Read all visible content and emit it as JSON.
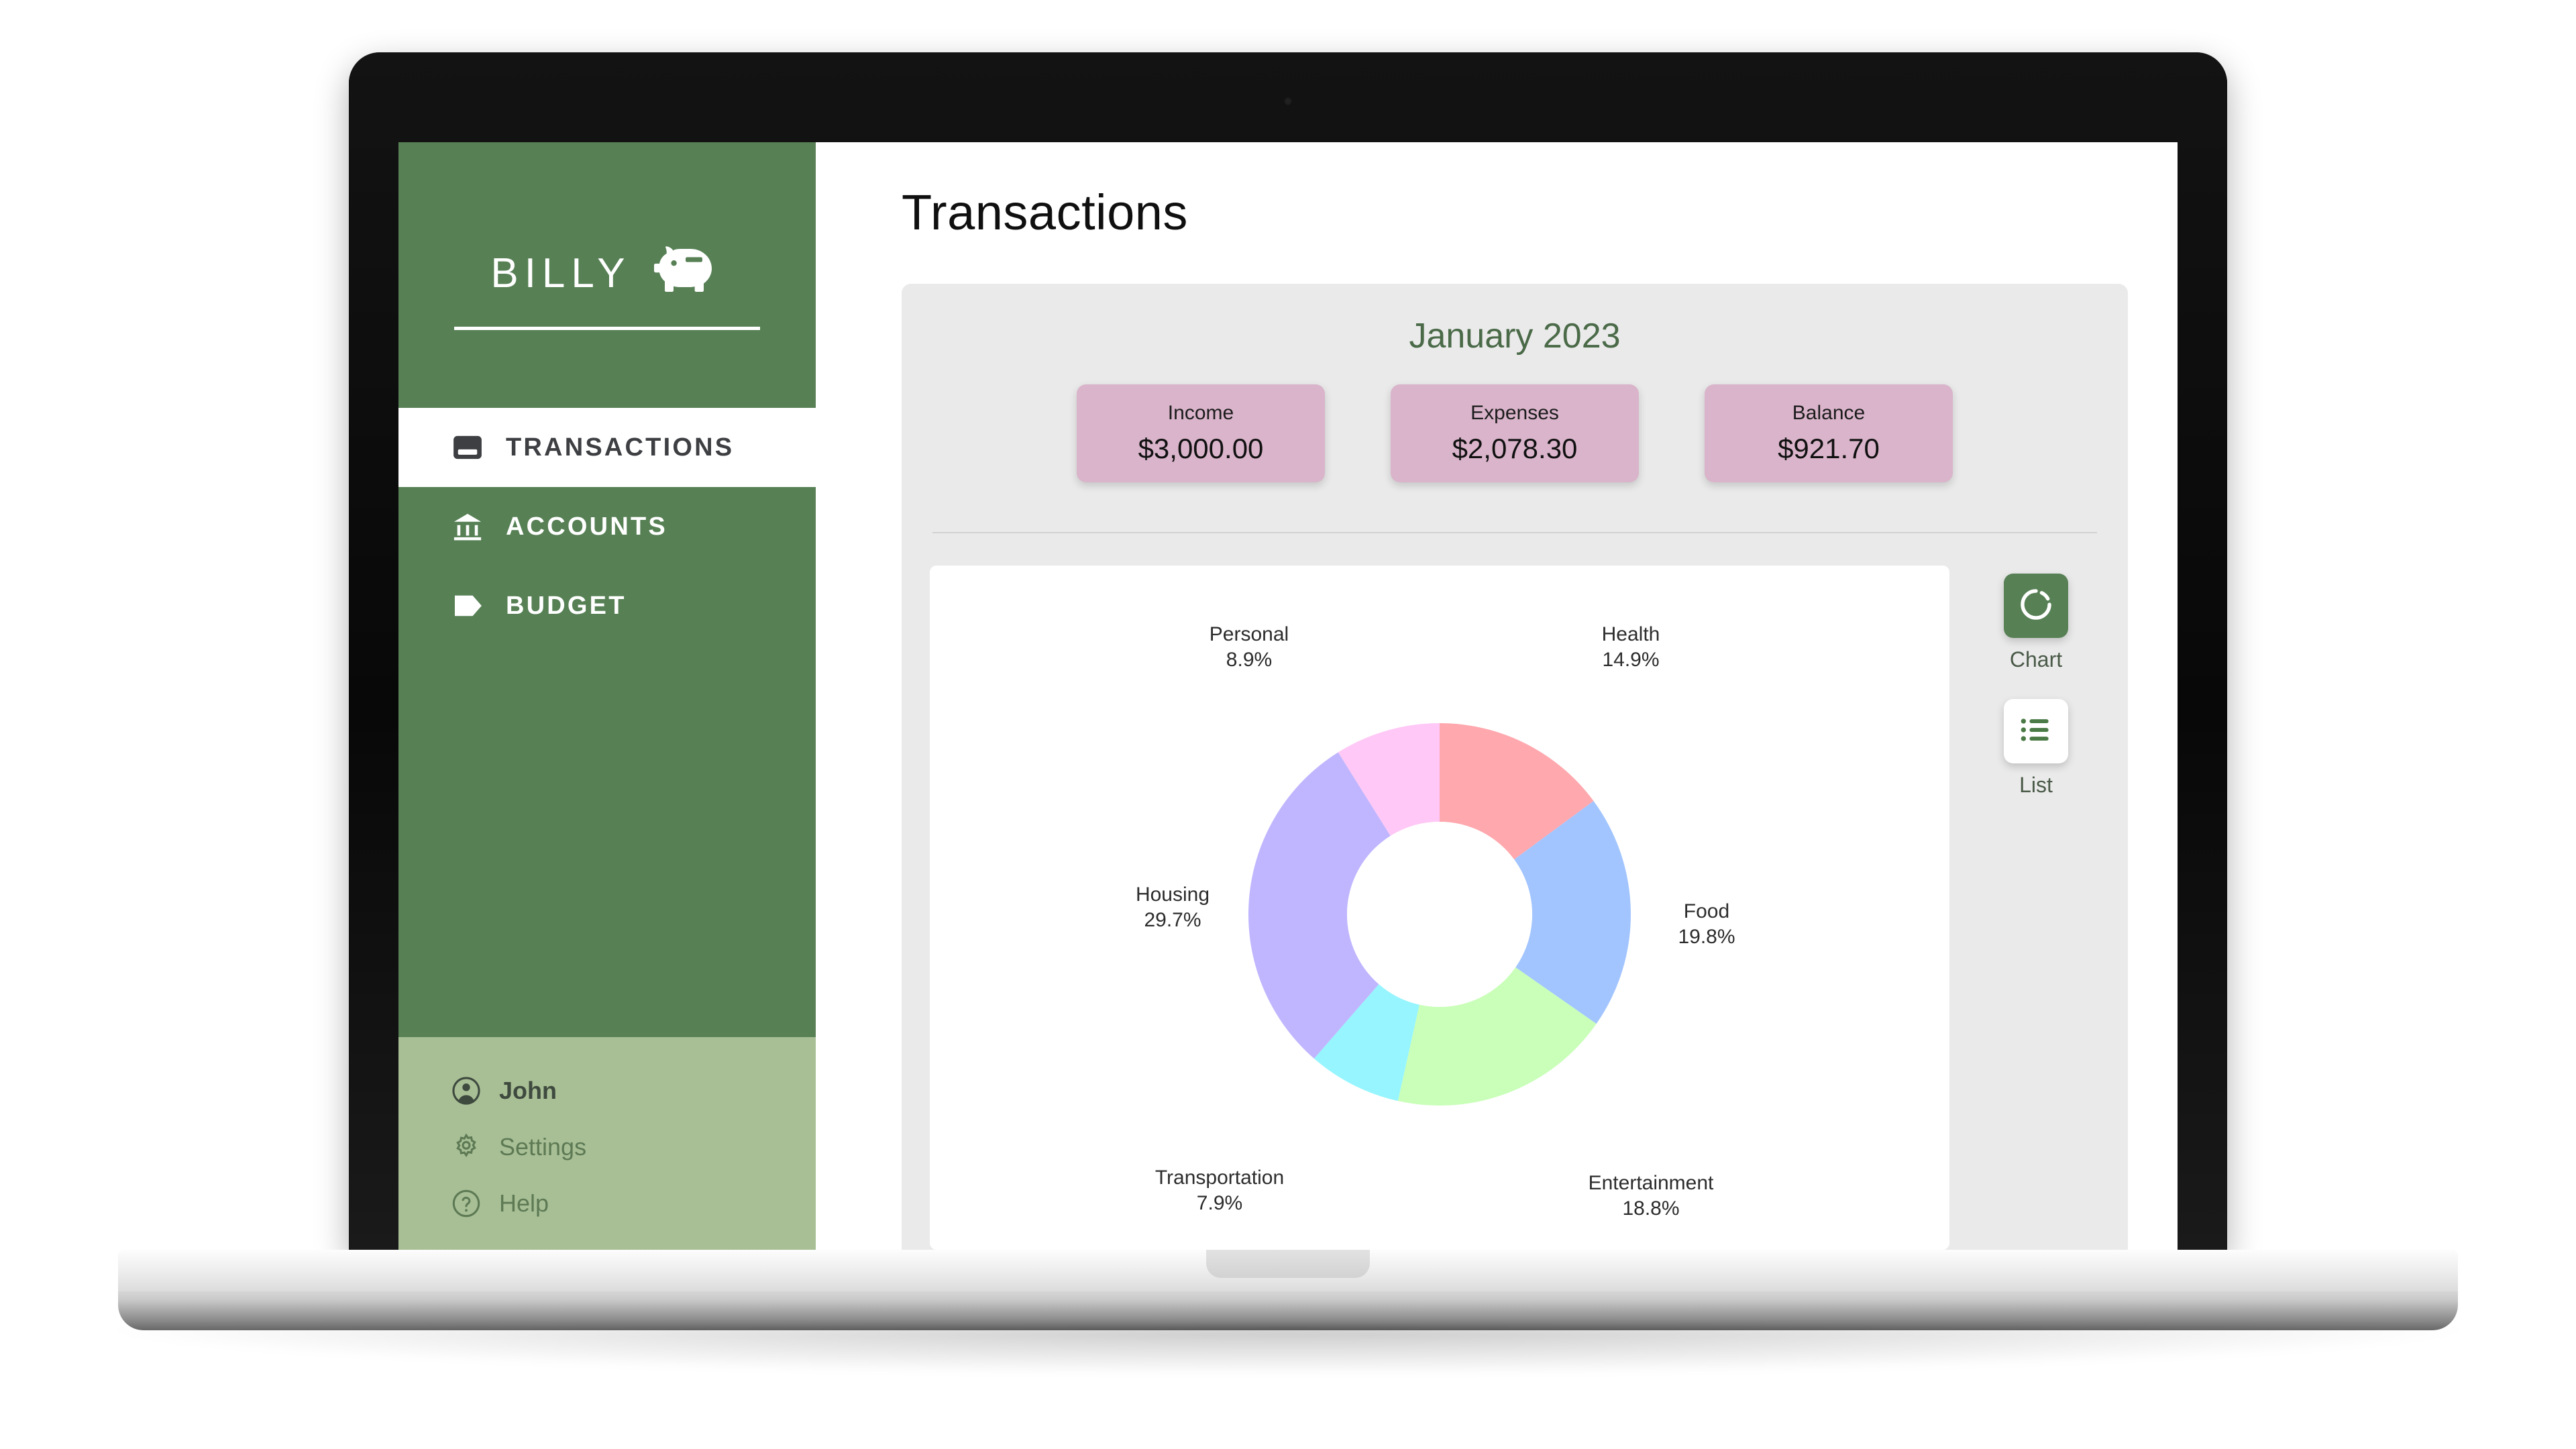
{
  "app": {
    "brand_name": "BILLY",
    "brand_icon": "piggy-bank-icon"
  },
  "sidebar": {
    "nav": [
      {
        "label": "TRANSACTIONS",
        "icon": "credit-card-icon",
        "active": true
      },
      {
        "label": "ACCOUNTS",
        "icon": "bank-icon",
        "active": false
      },
      {
        "label": "BUDGET",
        "icon": "tag-icon",
        "active": false
      }
    ],
    "footer": [
      {
        "label": "John",
        "icon": "user-circle-icon"
      },
      {
        "label": "Settings",
        "icon": "gear-icon"
      },
      {
        "label": "Help",
        "icon": "question-circle-icon"
      }
    ]
  },
  "main": {
    "page_title": "Transactions",
    "month_title": "January 2023",
    "summary_cards": [
      {
        "label": "Income",
        "value": "$3,000.00"
      },
      {
        "label": "Expenses",
        "value": "$2,078.30"
      },
      {
        "label": "Balance",
        "value": "$921.70"
      }
    ],
    "view_toggle": [
      {
        "label": "Chart",
        "icon": "donut-chart-icon",
        "active": true
      },
      {
        "label": "List",
        "icon": "list-icon",
        "active": false
      }
    ]
  },
  "colors": {
    "sidebar_green": "#578055",
    "sidebar_footer_green": "#a8bf95",
    "card_pink": "#d9b4ca",
    "panel_gray": "#eaeaea",
    "month_green": "#4a6a48"
  },
  "chart_data": {
    "type": "pie",
    "variant": "donut",
    "title": "",
    "legend_position": "labels-outside",
    "labels": [
      "Health",
      "Food",
      "Entertainment",
      "Transportation",
      "Housing",
      "Personal"
    ],
    "values": [
      14.9,
      19.8,
      18.8,
      7.9,
      29.7,
      8.9
    ],
    "unit": "%",
    "colors": [
      "#ffa8ae",
      "#a2c5ff",
      "#c9ffb8",
      "#96f5ff",
      "#c0b6ff",
      "#ffc8f6"
    ],
    "slices": [
      {
        "label": "Health",
        "value": 14.9,
        "display": "14.9%",
        "color": "#ffa8ae"
      },
      {
        "label": "Food",
        "value": 19.8,
        "display": "19.8%",
        "color": "#a2c5ff"
      },
      {
        "label": "Entertainment",
        "value": 18.8,
        "display": "18.8%",
        "color": "#c9ffb8"
      },
      {
        "label": "Transportation",
        "value": 7.9,
        "display": "7.9%",
        "color": "#96f5ff"
      },
      {
        "label": "Housing",
        "value": 29.7,
        "display": "29.7%",
        "color": "#c0b6ff"
      },
      {
        "label": "Personal",
        "value": 8.9,
        "display": "8.9%",
        "color": "#ffc8f6"
      }
    ]
  }
}
